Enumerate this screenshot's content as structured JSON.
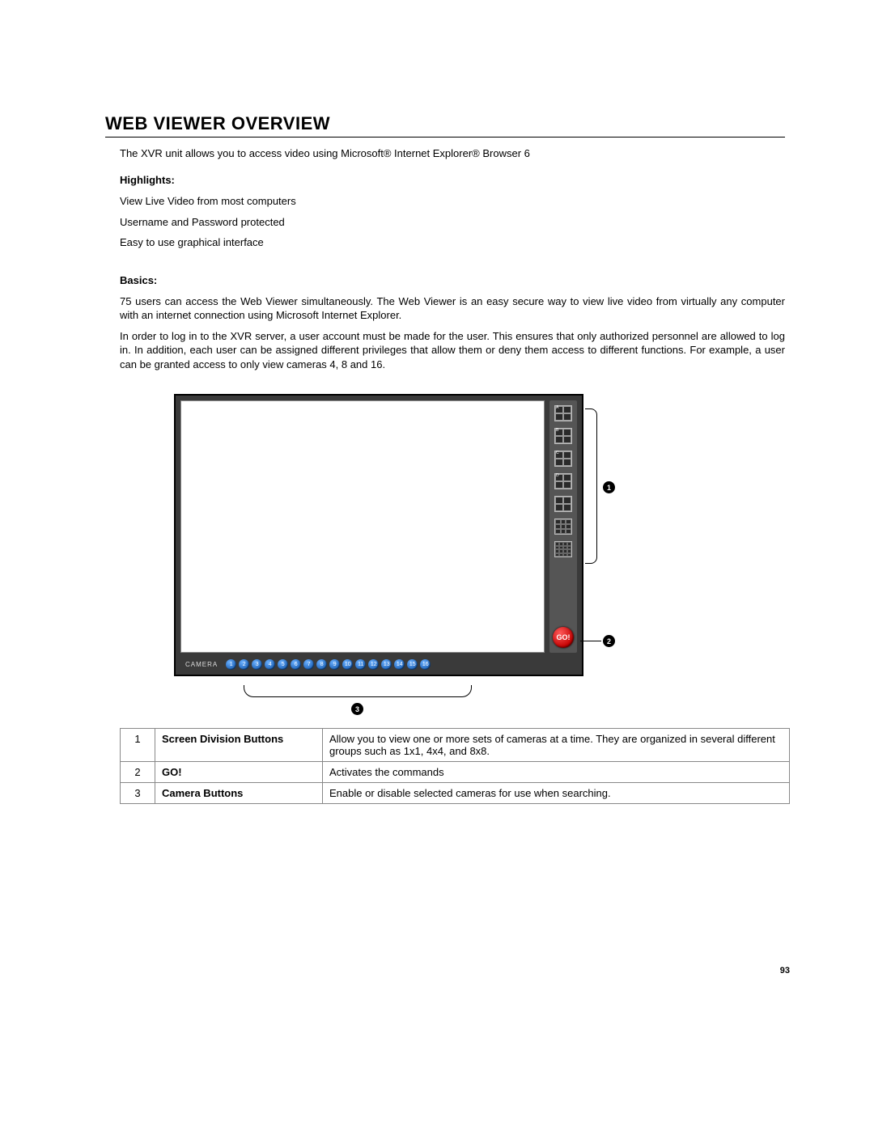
{
  "title": "WEB VIEWER OVERVIEW",
  "intro": "The XVR unit allows you to access video using Microsoft® Internet Explorer® Browser 6",
  "highlights_heading": "Highlights:",
  "highlights": [
    "View Live Video from most computers",
    "Username and Password protected",
    "Easy to use graphical interface"
  ],
  "basics_heading": "Basics:",
  "basics": [
    "75 users can access the Web Viewer simultaneously. The Web Viewer is an easy secure way to view live video from virtually any computer with an internet connection using Microsoft Internet Explorer.",
    "In order to log in to the XVR server, a user account must be made for the user. This ensures that only authorized personnel are allowed to log in.  In addition, each user can be assigned different privileges that allow them or deny them access to different functions.  For example, a user can be granted access to only view cameras 4, 8 and 16."
  ],
  "ui": {
    "camera_label": "CAMERA",
    "go_label": "GO!",
    "division_labels": [
      "A",
      "B",
      "C",
      "D"
    ],
    "camera_numbers": [
      "1",
      "2",
      "3",
      "4",
      "5",
      "6",
      "7",
      "8",
      "9",
      "10",
      "11",
      "12",
      "13",
      "14",
      "15",
      "16"
    ]
  },
  "callouts": {
    "c1": "1",
    "c2": "2",
    "c3": "3"
  },
  "legend": [
    {
      "num": "1",
      "label": "Screen Division Buttons",
      "desc": "Allow you to view one or more sets of cameras at a time.  They are organized in several different groups such as 1x1, 4x4, and 8x8."
    },
    {
      "num": "2",
      "label": "GO!",
      "desc": "Activates the commands"
    },
    {
      "num": "3",
      "label": "Camera Buttons",
      "desc": "Enable or disable selected cameras for use when searching."
    }
  ],
  "page_number": "93"
}
